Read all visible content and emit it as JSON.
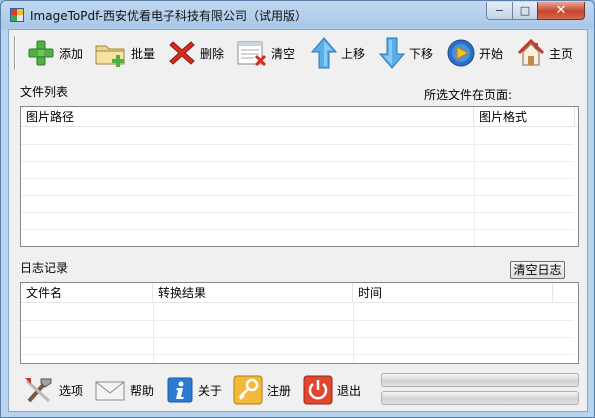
{
  "window": {
    "title": "ImageToPdf-西安优看电子科技有限公司（试用版）",
    "controls": {
      "minimize": "−",
      "maximize": "□",
      "close": "✕"
    }
  },
  "toolbar": {
    "add": "添加",
    "batch": "批量",
    "delete": "删除",
    "clear": "清空",
    "move_up": "上移",
    "move_down": "下移",
    "start": "开始",
    "home": "主页"
  },
  "file_list": {
    "label": "文件列表",
    "selected_page_label": "所选文件在页面:",
    "columns": [
      "图片路径",
      "图片格式"
    ]
  },
  "log": {
    "label": "日志记录",
    "clear_button": "清空日志",
    "columns": [
      "文件名",
      "转换结果",
      "时间"
    ]
  },
  "bottom": {
    "options": "选项",
    "help": "帮助",
    "about": "关于",
    "register": "注册",
    "exit": "退出"
  },
  "progress": [
    0,
    0
  ]
}
